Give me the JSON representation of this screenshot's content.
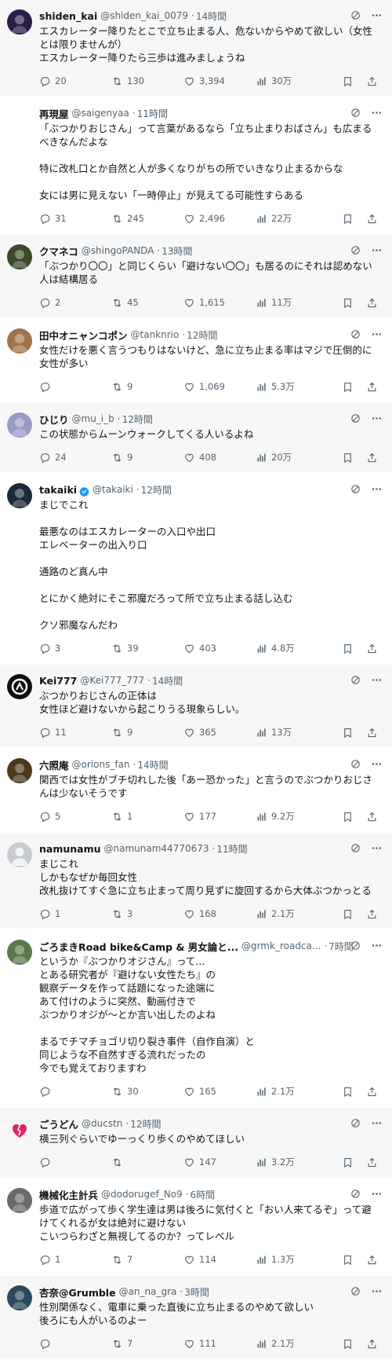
{
  "tweets": [
    {
      "name": "shiden_kai",
      "handle": "@shiden_kai_0079",
      "time": "14時間",
      "verified": false,
      "text": "エスカレーター降りたとこで立ち止まる人、危ないからやめて欲しい（女性とは限りませんが）\nエスカレーター降りたら三歩は進みましょうね",
      "replies": "20",
      "retweets": "130",
      "likes": "3,394",
      "views": "30万",
      "avatar_color": "#2b1d4a",
      "shade": true
    },
    {
      "name": "再現屋",
      "handle": "@saigenyaa",
      "time": "11時間",
      "verified": false,
      "text": "「ぶつかりおじさん」って言葉があるなら「立ち止まりおばさん」も広まるべきなんだよな\n\n特に改札口とか自然と人が多くなりがちの所でいきなり止まるからな\n\n女には男に見えない「一時停止」が見えてる可能性すらある",
      "replies": "31",
      "retweets": "245",
      "likes": "2,496",
      "views": "22万",
      "avatar_color": "",
      "shade": false
    },
    {
      "name": "クマネコ",
      "handle": "@shingoPANDA",
      "time": "13時間",
      "verified": false,
      "text": "「ぶつかり〇〇」と同じくらい「避けない〇〇」も居るのにそれは認めない人は結構居る",
      "replies": "2",
      "retweets": "45",
      "likes": "1,615",
      "views": "11万",
      "avatar_color": "#3a4a2a",
      "shade": true
    },
    {
      "name": "田中オニャンコポン",
      "handle": "@tanknrio",
      "time": "12時間",
      "verified": false,
      "text": "女性だけを悪く言うつもりはないけど、急に立ち止まる率はマジで圧倒的に女性が多い",
      "replies": "",
      "retweets": "9",
      "likes": "1,069",
      "views": "5.3万",
      "avatar_color": "#a0744a",
      "shade": false
    },
    {
      "name": "ひじり",
      "handle": "@mu_i_b",
      "time": "12時間",
      "verified": false,
      "text": "この状態からムーンウォークしてくる人いるよね",
      "replies": "24",
      "retweets": "9",
      "likes": "408",
      "views": "20万",
      "avatar_color": "#9a9ac8",
      "shade": true
    },
    {
      "name": "takaiki",
      "handle": "@takaiki",
      "time": "12時間",
      "verified": true,
      "text": "まじでこれ\n\n最悪なのはエスカレーターの入口や出口\nエレベーターの出入り口\n\n通路のど真ん中\n\nとにかく絶対にそこ邪魔だろって所で立ち止まる話し込む\n\nクソ邪魔なんだわ",
      "replies": "3",
      "retweets": "39",
      "likes": "403",
      "views": "4.8万",
      "avatar_color": "#1a2a3a",
      "shade": false
    },
    {
      "name": "Kei777",
      "handle": "@Kei777_777",
      "time": "14時間",
      "verified": false,
      "text": "ぶつかりおじさんの正体は\n女性ほど避けないから起こりうる現象らしい。",
      "replies": "11",
      "retweets": "9",
      "likes": "365",
      "views": "13万",
      "avatar_color": "#111111",
      "shade": true
    },
    {
      "name": "六照庵",
      "handle": "@orions_fan",
      "time": "14時間",
      "verified": false,
      "text": "関西では女性がブチ切れした後「あー恐かった」と言うのでぶつかりおじさんは少ないそうです",
      "replies": "5",
      "retweets": "1",
      "likes": "177",
      "views": "9.2万",
      "avatar_color": "#4a3a1a",
      "shade": false
    },
    {
      "name": "namunamu",
      "handle": "@namunam44770673",
      "time": "11時間",
      "verified": false,
      "text": "まじこれ\nしかもなぜか毎回女性\n改札抜けてすぐ急に立ち止まって周り見ずに旋回するから大体ぶつかっとる",
      "replies": "1",
      "retweets": "3",
      "likes": "168",
      "views": "2.1万",
      "avatar_color": "#c8ccd0",
      "shade": true
    },
    {
      "name": "ごろまきRoad bike&Camp & 男女論と...",
      "handle": "@grmk_roadca...",
      "time": "7時間",
      "verified": false,
      "text": "というか『ぶつかりオジさん』って...\nとある研究者が『避けない女性たち』の\n観察データを作って話題になった途端に\nあて付けのように突然、動画付きで\nぶつかりオジが〜とか言い出したのよね\n\nまるでチマチョゴリ切り裂き事件（自作自演）と\n同じような不自然すぎる流れだったの\n今でも覚えておりますわ",
      "replies": "",
      "retweets": "30",
      "likes": "165",
      "views": "2.1万",
      "avatar_color": "#5a7a4a",
      "shade": false
    },
    {
      "name": "ごうどん",
      "handle": "@ducstn",
      "time": "12時間",
      "verified": false,
      "text": "横三列ぐらいでゆーっくり歩くのやめてほしい",
      "replies": "",
      "retweets": "",
      "likes": "147",
      "views": "3.2万",
      "avatar_color": "#ffffff",
      "shade": true
    },
    {
      "name": "機械化主計兵",
      "handle": "@dodorugef_No9",
      "time": "6時間",
      "verified": false,
      "text": "歩道で広がって歩く学生達は男は後ろに気付くと「おい人来てるぞ」って避けてくれるが女は絶対に避けない\nこいつらわざと無視してるのか？ってレベル",
      "replies": "1",
      "retweets": "7",
      "likes": "114",
      "views": "1.3万",
      "avatar_color": "#6a6a6a",
      "shade": false
    },
    {
      "name": "杏奈@Grumble",
      "handle": "@an_na_gra",
      "time": "3時間",
      "verified": false,
      "text": "性別関係なく、電車に乗った直後に立ち止まるのやめて欲しい\n後ろにも人がいるのよー",
      "replies": "",
      "retweets": "7",
      "likes": "111",
      "views": "2.1万",
      "avatar_color": "#2a4a5a",
      "shade": true
    }
  ],
  "icons": {
    "reply": "reply-icon",
    "retweet": "retweet-icon",
    "like": "heart-icon",
    "views": "views-icon",
    "bookmark": "bookmark-icon",
    "share": "share-icon",
    "grok": "grok-icon",
    "more": "more-icon",
    "verified": "verified-badge-icon"
  },
  "colors": {
    "text": "#0f1419",
    "muted": "#536471",
    "shade_bg": "#f7f7f7",
    "verified": "#1d9bf0",
    "broken_heart": "#e0245e"
  }
}
